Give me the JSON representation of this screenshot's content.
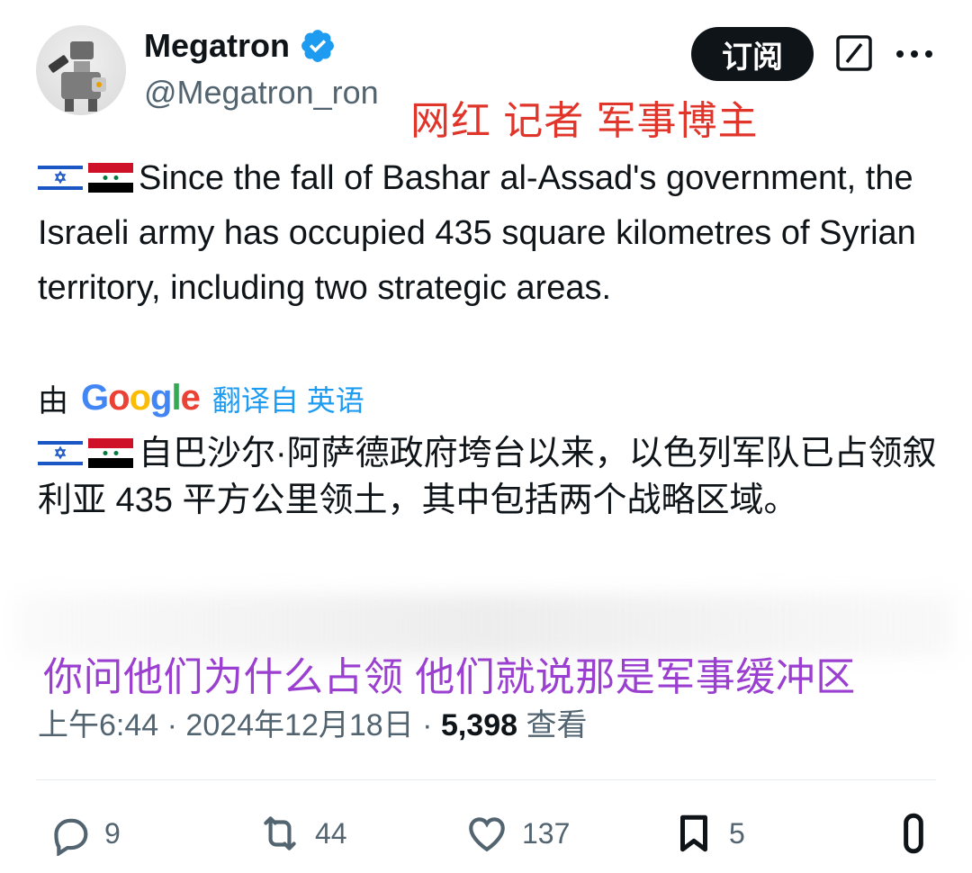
{
  "author": {
    "name": "Megatron",
    "handle": "@Megatron_ron"
  },
  "header": {
    "subscribe_label": "订阅"
  },
  "annotation_red": "网红 记者 军事博主",
  "tweet": {
    "english_text": "Since the fall of Bashar al-Assad's government, the Israeli army has occupied 435 square kilometres of Syrian territory, including two strategic areas.",
    "translated_by_prefix": "由",
    "translated_by_brand": "Google",
    "translate_label": "翻译自 英语",
    "chinese_text": "自巴沙尔·阿萨德政府垮台以来，以色列军队已占领叙利亚 435 平方公里领土，其中包括两个战略区域。"
  },
  "annotation_purple": "你问他们为什么占领 他们就说那是军事缓冲区",
  "meta": {
    "time": "上午6:44",
    "date": "2024年12月18日",
    "views_count": "5,398",
    "views_label": "查看"
  },
  "actions": {
    "replies": "9",
    "retweets": "44",
    "likes": "137",
    "bookmarks": "5"
  },
  "colors": {
    "accent": "#1d9bf0",
    "annotation_red": "#e0352b",
    "annotation_purple": "#9b3fd0",
    "muted": "#536471"
  },
  "icons": [
    "verified-badge-icon",
    "grok-icon",
    "more-icon",
    "israel-flag-icon",
    "syria-flag-icon",
    "reply-icon",
    "retweet-icon",
    "like-icon",
    "bookmark-icon",
    "share-icon"
  ]
}
